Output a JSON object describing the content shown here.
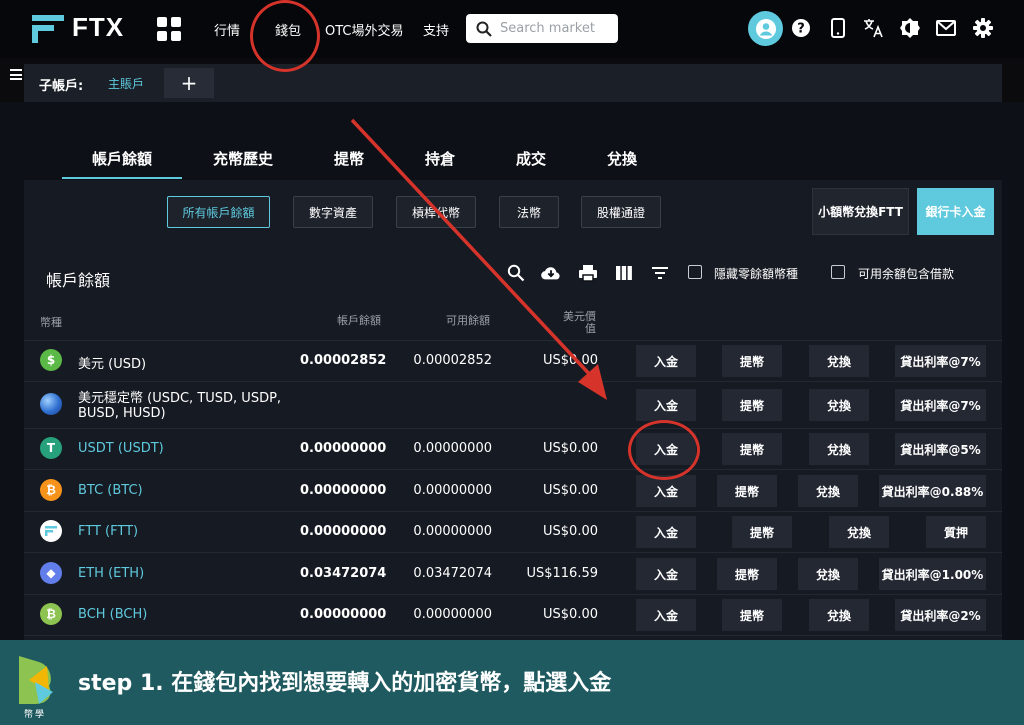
{
  "brand": {
    "logo_text": "FTX"
  },
  "nav": {
    "links": [
      "行情",
      "錢包",
      "OTC場外交易",
      "支持"
    ],
    "search_placeholder": "Search market"
  },
  "subaccount": {
    "label": "子帳戶:",
    "current": "主賬戶",
    "add": "+"
  },
  "tabs": [
    "帳戶餘額",
    "充幣歷史",
    "提幣",
    "持倉",
    "成交",
    "兌換"
  ],
  "filters": [
    "所有帳戶餘額",
    "數字資產",
    "槓桿代幣",
    "法幣",
    "股權通證"
  ],
  "buttons": {
    "small_swap": "小額幣兌換FTT",
    "bank_deposit": "銀行卡入金"
  },
  "section_title": "帳戶餘額",
  "options": {
    "hide_zero": "隱藏零餘額幣種",
    "include_borrow": "可用余額包含借款"
  },
  "table": {
    "headers": {
      "coin": "幣種",
      "balance": "帳戶餘額",
      "available": "可用餘額",
      "usd_value_line1": "美元價",
      "usd_value_line2": "值"
    },
    "rows": [
      {
        "name": "美元 (USD)",
        "name2": "",
        "balance": "0.00002852",
        "available": "0.00002852",
        "usd": "US$0.00",
        "deposit": "入金",
        "withdraw": "提幣",
        "convert": "兌換",
        "lend": "貸出利率@7%",
        "icon_char": "$",
        "icon_color": "#5bb947",
        "name_color": "#ffffff"
      },
      {
        "name": "美元穩定幣 (USDC, TUSD, USDP,",
        "name2": "BUSD, HUSD)",
        "balance": "",
        "available": "",
        "usd": "",
        "deposit": "入金",
        "withdraw": "提幣",
        "convert": "兌換",
        "lend": "貸出利率@7%",
        "icon_char": "",
        "icon_color": "#3a7bd5",
        "name_color": "#ffffff"
      },
      {
        "name": "USDT (USDT)",
        "name2": "",
        "balance": "0.00000000",
        "available": "0.00000000",
        "usd": "US$0.00",
        "deposit": "入金",
        "withdraw": "提幣",
        "convert": "兌換",
        "lend": "貸出利率@5%",
        "icon_char": "T",
        "icon_color": "#26a17b",
        "name_color": "#5fcade"
      },
      {
        "name": "BTC (BTC)",
        "name2": "",
        "balance": "0.00000000",
        "available": "0.00000000",
        "usd": "US$0.00",
        "deposit": "入金",
        "withdraw": "提幣",
        "convert": "兌換",
        "lend": "貸出利率@0.88%",
        "icon_char": "₿",
        "icon_color": "#f7931a",
        "name_color": "#5fcade"
      },
      {
        "name": "FTT (FTT)",
        "name2": "",
        "balance": "0.00000000",
        "available": "0.00000000",
        "usd": "US$0.00",
        "deposit": "入金",
        "withdraw": "提幣",
        "convert": "兌換",
        "lend": "質押",
        "icon_char": "",
        "icon_color": "#ffffff",
        "name_color": "#5fcade"
      },
      {
        "name": "ETH (ETH)",
        "name2": "",
        "balance": "0.03472074",
        "available": "0.03472074",
        "usd": "US$116.59",
        "deposit": "入金",
        "withdraw": "提幣",
        "convert": "兌換",
        "lend": "貸出利率@1.00%",
        "icon_char": "◆",
        "icon_color": "#627eea",
        "name_color": "#5fcade"
      },
      {
        "name": "BCH (BCH)",
        "name2": "",
        "balance": "0.00000000",
        "available": "0.00000000",
        "usd": "US$0.00",
        "deposit": "入金",
        "withdraw": "提幣",
        "convert": "兌換",
        "lend": "貸出利率@2%",
        "icon_char": "₿",
        "icon_color": "#8dc351",
        "name_color": "#5fcade"
      }
    ]
  },
  "caption": {
    "text": "step 1. 在錢包內找到想要轉入的加密貨幣，點選入金",
    "logo_text": "幣學"
  },
  "colors": {
    "accent": "#5fcade",
    "annotation": "#d6332a",
    "caption_bg": "#1e5a5f"
  }
}
